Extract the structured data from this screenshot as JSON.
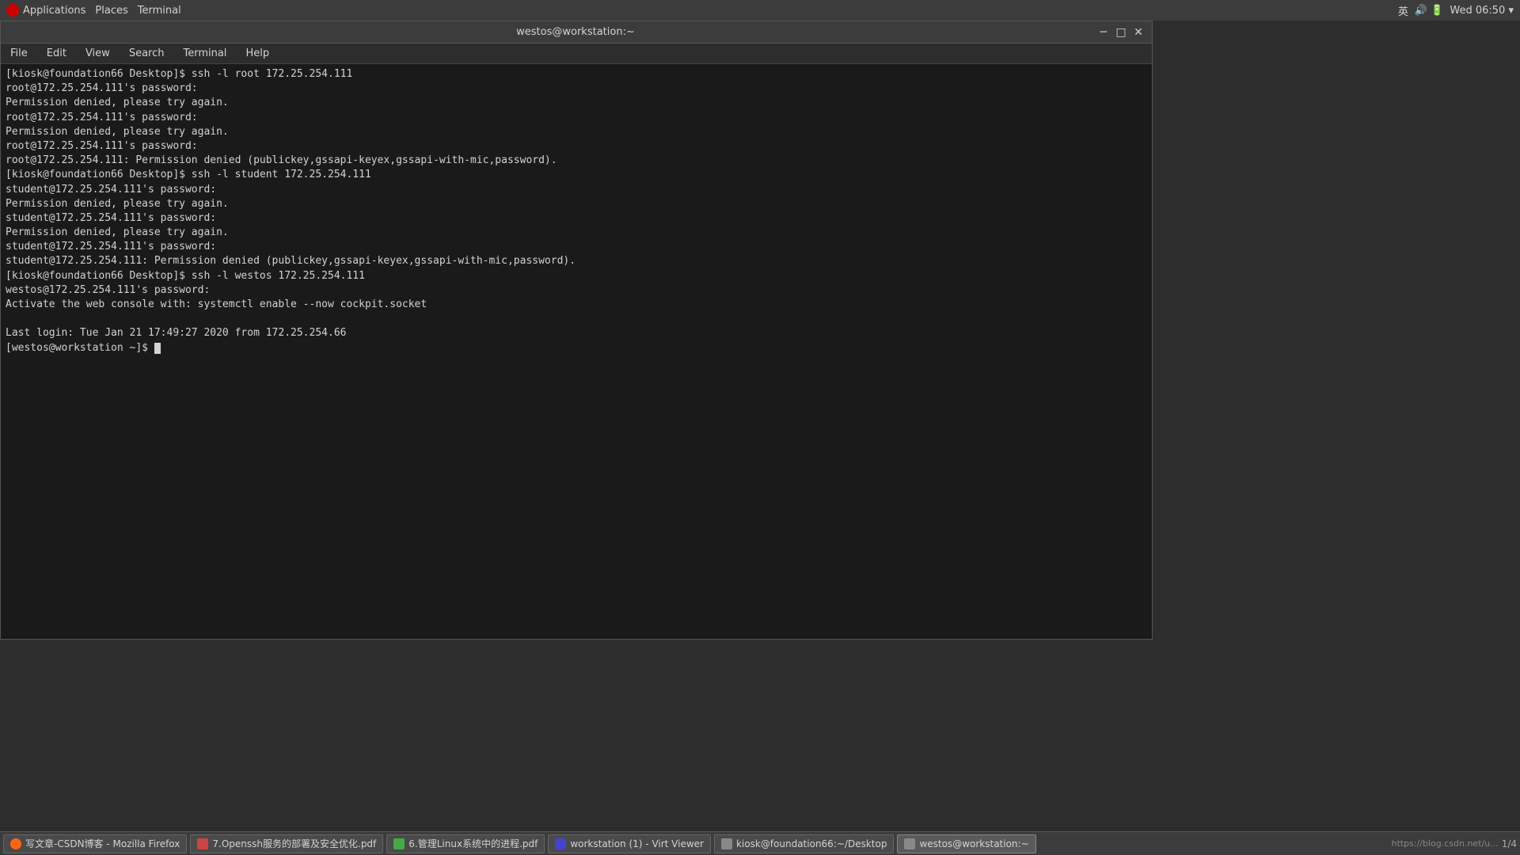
{
  "topbar": {
    "applications_label": "Applications",
    "places_label": "Places",
    "terminal_label": "Terminal",
    "datetime": "Wed 06:50 ▾",
    "lang": "英"
  },
  "window": {
    "title": "westos@workstation:~",
    "menu_items": [
      "File",
      "Edit",
      "View",
      "Search",
      "Terminal",
      "Help"
    ]
  },
  "terminal": {
    "lines": [
      "[kiosk@foundation66 Desktop]$ ssh -l root 172.25.254.111",
      "root@172.25.254.111's password: ",
      "Permission denied, please try again.",
      "root@172.25.254.111's password: ",
      "Permission denied, please try again.",
      "root@172.25.254.111's password: ",
      "root@172.25.254.111: Permission denied (publickey,gssapi-keyex,gssapi-with-mic,password).",
      "[kiosk@foundation66 Desktop]$ ssh -l student 172.25.254.111",
      "student@172.25.254.111's password: ",
      "Permission denied, please try again.",
      "student@172.25.254.111's password: ",
      "Permission denied, please try again.",
      "student@172.25.254.111's password: ",
      "student@172.25.254.111: Permission denied (publickey,gssapi-keyex,gssapi-with-mic,password).",
      "[kiosk@foundation66 Desktop]$ ssh -l westos 172.25.254.111",
      "westos@172.25.254.111's password: ",
      "Activate the web console with: systemctl enable --now cockpit.socket",
      "",
      "Last login: Tue Jan 21 17:49:27 2020 from 172.25.254.66",
      "[westos@workstation ~]$ "
    ]
  },
  "taskbar": {
    "items": [
      {
        "id": "firefox",
        "label": "写文章-CSDN博客 - Mozilla Firefox",
        "icon_type": "firefox"
      },
      {
        "id": "pdf1",
        "label": "7.Openssh服务的部署及安全优化.pdf",
        "icon_type": "pdf"
      },
      {
        "id": "pdf2",
        "label": "6.管理Linux系统中的进程.pdf",
        "icon_type": "green"
      },
      {
        "id": "virt",
        "label": "workstation (1) - Virt Viewer",
        "icon_type": "virt"
      },
      {
        "id": "desktop",
        "label": "kiosk@foundation66:~/Desktop",
        "icon_type": "term"
      },
      {
        "id": "term",
        "label": "westos@workstation:~",
        "icon_type": "term",
        "active": true
      }
    ],
    "url": "https://blog.csdn.net/u...",
    "page": "1/4"
  }
}
